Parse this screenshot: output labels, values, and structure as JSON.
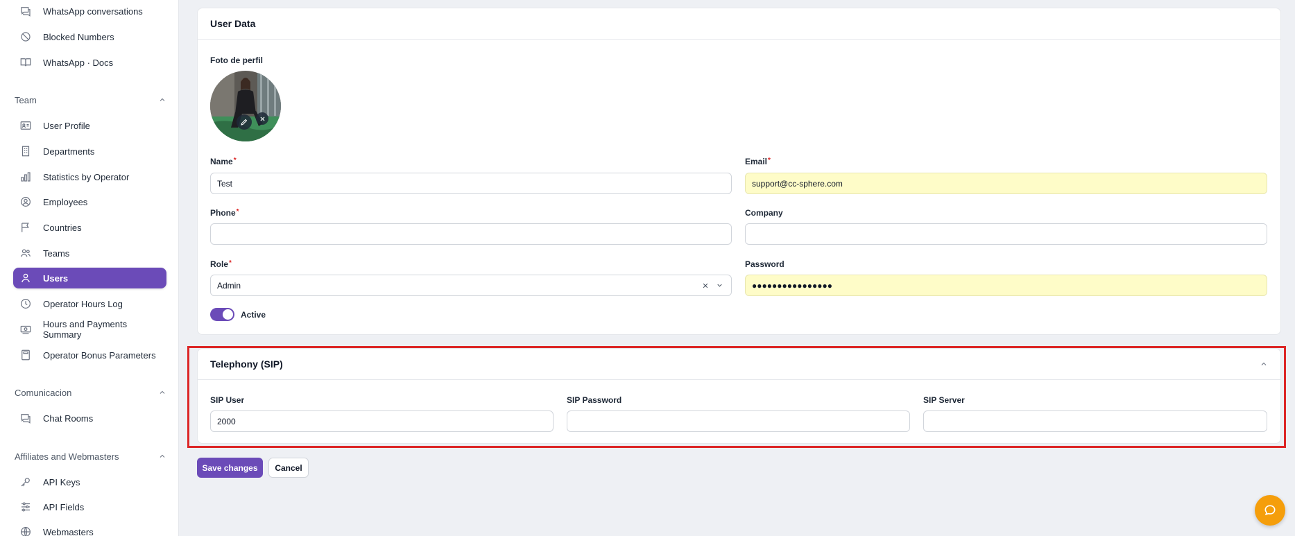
{
  "sidebar": {
    "whatsapp_items": [
      {
        "label": "WhatsApp conversations",
        "icon": "chat-bubble-icon"
      },
      {
        "label": "Blocked Numbers",
        "icon": "blocked-icon"
      },
      {
        "label": "WhatsApp · Docs",
        "icon": "book-icon"
      }
    ],
    "team_section": "Team",
    "team_items": [
      {
        "label": "User Profile",
        "icon": "id-card-icon"
      },
      {
        "label": "Departments",
        "icon": "building-icon"
      },
      {
        "label": "Statistics by Operator",
        "icon": "bar-chart-icon"
      },
      {
        "label": "Employees",
        "icon": "user-circle-icon"
      },
      {
        "label": "Countries",
        "icon": "flag-icon"
      },
      {
        "label": "Teams",
        "icon": "users-icon"
      },
      {
        "label": "Users",
        "icon": "user-icon",
        "active": true
      },
      {
        "label": "Operator Hours Log",
        "icon": "clock-icon"
      },
      {
        "label": "Hours and Payments Summary",
        "icon": "money-icon"
      },
      {
        "label": "Operator Bonus Parameters",
        "icon": "calculator-icon"
      }
    ],
    "comm_section": "Comunicacion",
    "comm_items": [
      {
        "label": "Chat Rooms",
        "icon": "chat-bubble-icon"
      }
    ],
    "aff_section": "Affiliates and Webmasters",
    "aff_items": [
      {
        "label": "API Keys",
        "icon": "key-icon"
      },
      {
        "label": "API Fields",
        "icon": "sliders-icon"
      },
      {
        "label": "Webmasters",
        "icon": "globe-icon"
      }
    ]
  },
  "user_data": {
    "title": "User Data",
    "photo_label": "Foto de perfil",
    "name_label": "Name",
    "name_value": "Test",
    "email_label": "Email",
    "email_value": "support@cc-sphere.com",
    "phone_label": "Phone",
    "phone_value": "",
    "company_label": "Company",
    "company_value": "",
    "role_label": "Role",
    "role_value": "Admin",
    "password_label": "Password",
    "password_value": "●●●●●●●●●●●●●●●●",
    "required_mark": "*",
    "active_label": "Active",
    "active_on": true
  },
  "telephony": {
    "title": "Telephony (SIP)",
    "sip_user_label": "SIP User",
    "sip_user_value": "2000",
    "sip_password_label": "SIP Password",
    "sip_password_value": "",
    "sip_server_label": "SIP Server",
    "sip_server_value": ""
  },
  "actions": {
    "save_label": "Save changes",
    "cancel_label": "Cancel"
  },
  "colors": {
    "accent": "#6b4bb8",
    "autofill": "#fefcc8",
    "highlight": "#dc2626",
    "chat_fab": "#f59e0b"
  }
}
